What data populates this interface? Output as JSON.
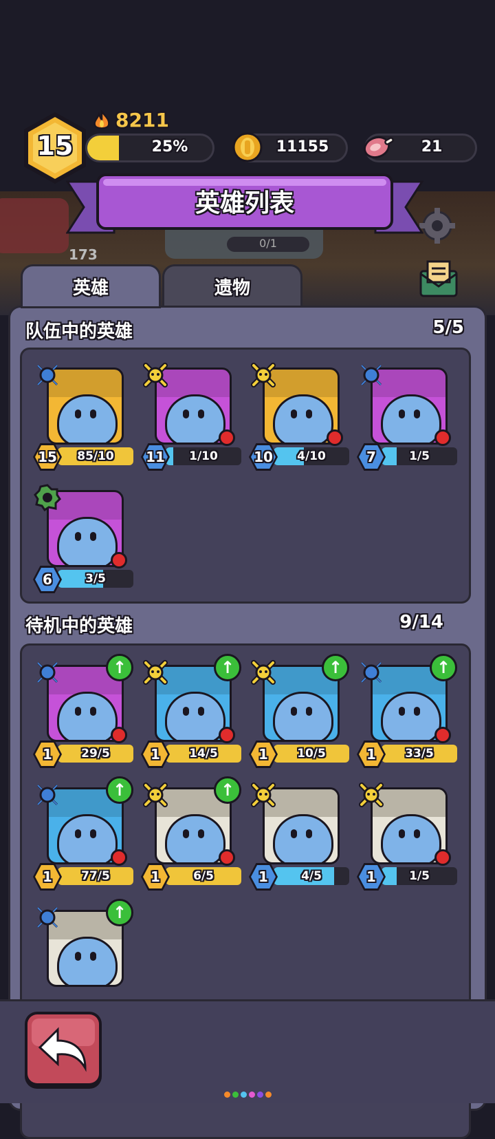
{
  "player": {
    "level": "15",
    "power": "8211",
    "xp_percent": "25%",
    "xp_fraction": 0.25,
    "coins": "11155",
    "meat": "21"
  },
  "banner": {
    "title": "英雄列表"
  },
  "tabs": [
    {
      "label": "英雄"
    },
    {
      "label": "遗物"
    }
  ],
  "background": {
    "counter": "0/1",
    "number": "173"
  },
  "team": {
    "title": "队伍中的英雄",
    "count": "5/5"
  },
  "standby": {
    "title": "待机中的英雄",
    "count": "9/14"
  },
  "team_heroes": [
    {
      "level": "15",
      "progress": "85/10",
      "fill": 1.0,
      "class": "mage",
      "color": "#f3b734",
      "bar": "#f0c53a",
      "reddot": false,
      "up": false
    },
    {
      "level": "11",
      "progress": "1/10",
      "fill": 0.1,
      "class": "assassin",
      "color": "#c552d8",
      "bar": "#54c4ef",
      "reddot": true,
      "up": false
    },
    {
      "level": "10",
      "progress": "4/10",
      "fill": 0.4,
      "class": "assassin",
      "color": "#f3b734",
      "bar": "#54c4ef",
      "reddot": true,
      "up": false
    },
    {
      "level": "7",
      "progress": "1/5",
      "fill": 0.2,
      "class": "mage",
      "color": "#c552d8",
      "bar": "#54c4ef",
      "reddot": true,
      "up": false
    },
    {
      "level": "6",
      "progress": "3/5",
      "fill": 0.6,
      "class": "tank",
      "color": "#c552d8",
      "bar": "#54c4ef",
      "reddot": true,
      "up": false
    }
  ],
  "standby_heroes": [
    {
      "level": "1",
      "progress": "29/5",
      "fill": 1.0,
      "class": "mage",
      "color": "#c552d8",
      "bar": "#f0c53a",
      "reddot": true,
      "up": true
    },
    {
      "level": "1",
      "progress": "14/5",
      "fill": 1.0,
      "class": "assassin",
      "color": "#4ab1ea",
      "bar": "#f0c53a",
      "reddot": true,
      "up": true
    },
    {
      "level": "1",
      "progress": "10/5",
      "fill": 1.0,
      "class": "assassin",
      "color": "#4ab1ea",
      "bar": "#f0c53a",
      "reddot": false,
      "up": true
    },
    {
      "level": "1",
      "progress": "33/5",
      "fill": 1.0,
      "class": "mage",
      "color": "#4ab1ea",
      "bar": "#f0c53a",
      "reddot": true,
      "up": true
    },
    {
      "level": "1",
      "progress": "77/5",
      "fill": 1.0,
      "class": "mage",
      "color": "#4ab1ea",
      "bar": "#f0c53a",
      "reddot": true,
      "up": true
    },
    {
      "level": "1",
      "progress": "6/5",
      "fill": 1.0,
      "class": "assassin",
      "color": "#e8e4d8",
      "bar": "#f0c53a",
      "reddot": true,
      "up": true
    },
    {
      "level": "1",
      "progress": "4/5",
      "fill": 0.8,
      "class": "assassin",
      "color": "#e8e4d8",
      "bar": "#54c4ef",
      "reddot": false,
      "up": false
    },
    {
      "level": "1",
      "progress": "1/5",
      "fill": 0.2,
      "class": "assassin",
      "color": "#e8e4d8",
      "bar": "#54c4ef",
      "reddot": true,
      "up": false
    },
    {
      "level": "",
      "progress": "",
      "fill": 0,
      "class": "mage",
      "color": "#e8e4d8",
      "bar": "#f0c53a",
      "reddot": false,
      "up": true
    }
  ],
  "colors": {
    "gold": "#f3b734",
    "purple_banner": "#a857d3",
    "panel": "#6b6a8b",
    "back_button": "#c24a5a"
  },
  "icons": {
    "back": "back-arrow-icon",
    "settings": "gear-icon",
    "mail": "mail-icon",
    "coin": "coin-icon",
    "meat": "meat-icon",
    "fire": "flame-icon"
  }
}
